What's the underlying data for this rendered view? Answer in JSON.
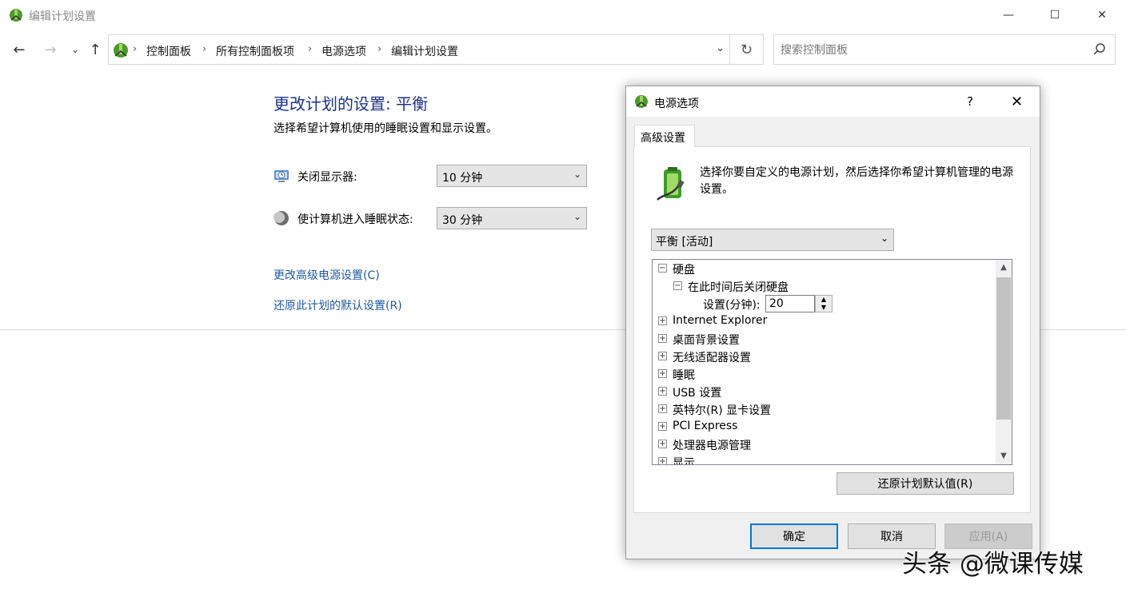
{
  "window": {
    "title": "编辑计划设置",
    "minimize": "—",
    "maximize": "☐",
    "close": "✕"
  },
  "nav": {
    "back": "←",
    "forward": "→",
    "recent": "⌄",
    "up": "↑",
    "breadcrumbs": [
      "控制面板",
      "所有控制面板项",
      "电源选项",
      "编辑计划设置"
    ],
    "separator": "›",
    "dropdown": "⌄",
    "refresh": "↻",
    "search_placeholder": "搜索控制面板"
  },
  "page": {
    "title": "更改计划的设置: 平衡",
    "subtitle": "选择希望计算机使用的睡眠设置和显示设置。",
    "display_off_label": "关闭显示器:",
    "display_off_value": "10 分钟",
    "sleep_label": "使计算机进入睡眠状态:",
    "sleep_value": "30 分钟",
    "link_advanced": "更改高级电源设置(C)",
    "link_restore": "还原此计划的默认设置(R)",
    "dropdown_arrow": "⌄"
  },
  "dialog": {
    "title": "电源选项",
    "help": "?",
    "close": "✕",
    "tab": "高级设置",
    "description": "选择你要自定义的电源计划，然后选择你希望计算机管理的电源设置。",
    "plan_value": "平衡 [活动]",
    "tree": {
      "hard_disk": "硬盘",
      "turn_off_after": "在此时间后关闭硬盘",
      "setting_label": "设置(分钟):",
      "setting_value": "20",
      "items": [
        "Internet Explorer",
        "桌面背景设置",
        "无线适配器设置",
        "睡眠",
        "USB 设置",
        "英特尔(R) 显卡设置",
        "PCI Express",
        "处理器电源管理",
        "显示"
      ]
    },
    "restore_button": "还原计划默认值(R)",
    "ok_button": "确定",
    "cancel_button": "取消",
    "apply_button": "应用(A)"
  },
  "watermark": "头条 @微课传媒"
}
